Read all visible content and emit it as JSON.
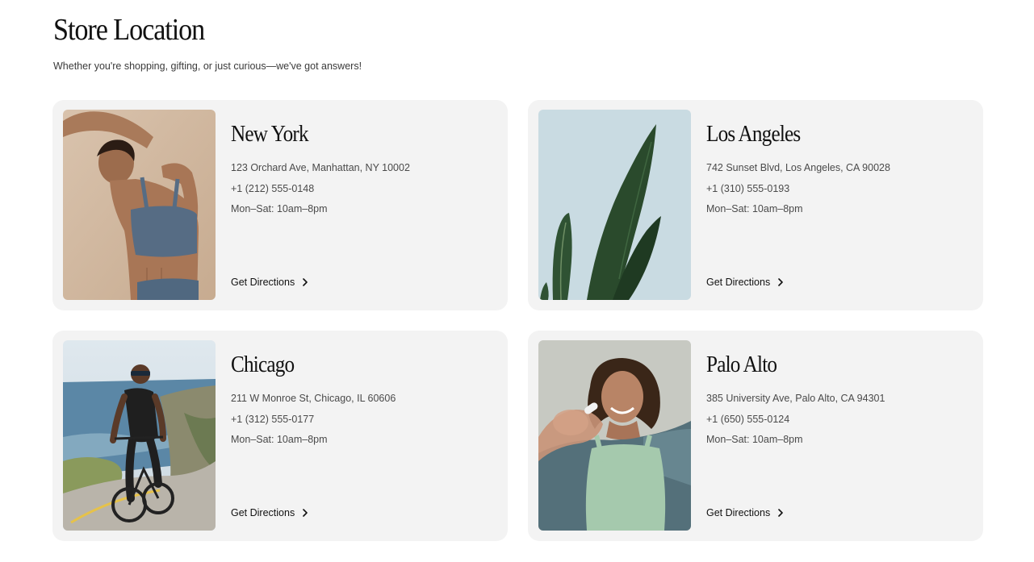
{
  "header": {
    "title": "Store Location",
    "subtitle": "Whether you're shopping, gifting, or just curious—we've got answers!"
  },
  "stores": [
    {
      "city": "New York",
      "address": "123 Orchard Ave, Manhattan, NY 10002",
      "phone": "+1 (212) 555-0148",
      "hours": "Mon–Sat: 10am–8pm",
      "cta": "Get Directions",
      "image": "woman-stretching-sports-bra-photo"
    },
    {
      "city": "Los Angeles",
      "address": "742 Sunset Blvd, Los Angeles, CA 90028",
      "phone": "+1 (310) 555-0193",
      "hours": "Mon–Sat: 10am–8pm",
      "cta": "Get Directions",
      "image": "snake-plant-leaves-photo"
    },
    {
      "city": "Chicago",
      "address": "211 W Monroe St, Chicago, IL 60606",
      "phone": "+1 (312) 555-0177",
      "hours": "Mon–Sat: 10am–8pm",
      "cta": "Get Directions",
      "image": "cyclist-coastal-road-photo"
    },
    {
      "city": "Palo Alto",
      "address": "385 University Ave, Palo Alto, CA 94301",
      "phone": "+1 (650) 555-0124",
      "hours": "Mon–Sat: 10am–8pm",
      "cta": "Get Directions",
      "image": "woman-holding-capsule-photo"
    }
  ],
  "icons": {
    "cta_icon": "chevron-right-icon"
  },
  "colors": {
    "card_background": "#f3f3f3",
    "text_primary": "#111111",
    "text_secondary": "#4a4a4a"
  }
}
